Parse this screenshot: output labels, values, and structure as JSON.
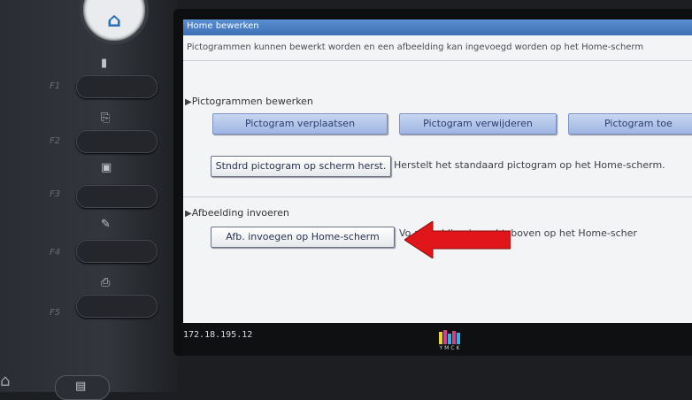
{
  "device": {
    "home_button_glyph": "⌂",
    "function_keys": [
      {
        "label": "F1",
        "icon_name": "document-icon",
        "glyph": "▮"
      },
      {
        "label": "F2",
        "icon_name": "copy-icon",
        "glyph": "⎘"
      },
      {
        "label": "F3",
        "icon_name": "scanner-icon",
        "glyph": "▣"
      },
      {
        "label": "F4",
        "icon_name": "pen-icon",
        "glyph": "✎"
      },
      {
        "label": "F5",
        "icon_name": "printer-icon",
        "glyph": "⎙"
      }
    ],
    "bottom_key_glyph": "▤"
  },
  "screen": {
    "title": "Home bewerken",
    "description": "Pictogrammen kunnen bewerkt worden en een afbeelding kan ingevoegd worden op het Home-scherm",
    "section_icons": {
      "edit": "pictogrammen-bewerken-section",
      "image": "afbeelding-invoeren-section"
    },
    "sections": {
      "edit_label": "Pictogrammen bewerken",
      "image_label": "Afbeelding invoeren"
    },
    "buttons": {
      "move": "Pictogram verplaatsen",
      "delete": "Pictogram verwijderen",
      "add": "Pictogram toe",
      "restore": "Stndrd pictogram op scherm herst.",
      "insert_image": "Afb. invoegen op Home-scherm"
    },
    "notes": {
      "restore": "Herstelt het standaard pictogram op het Home-scherm.",
      "insert_image": "Vo          afbeelding in rechtsboven op het Home-scher"
    }
  },
  "status_bar": {
    "ip_address": "172.18.195.12",
    "logo_text": "YMCK"
  },
  "colors": {
    "title_bar": "#3e70b5",
    "arrow": "#e0161a",
    "button_blue": "#b4c6ea"
  }
}
